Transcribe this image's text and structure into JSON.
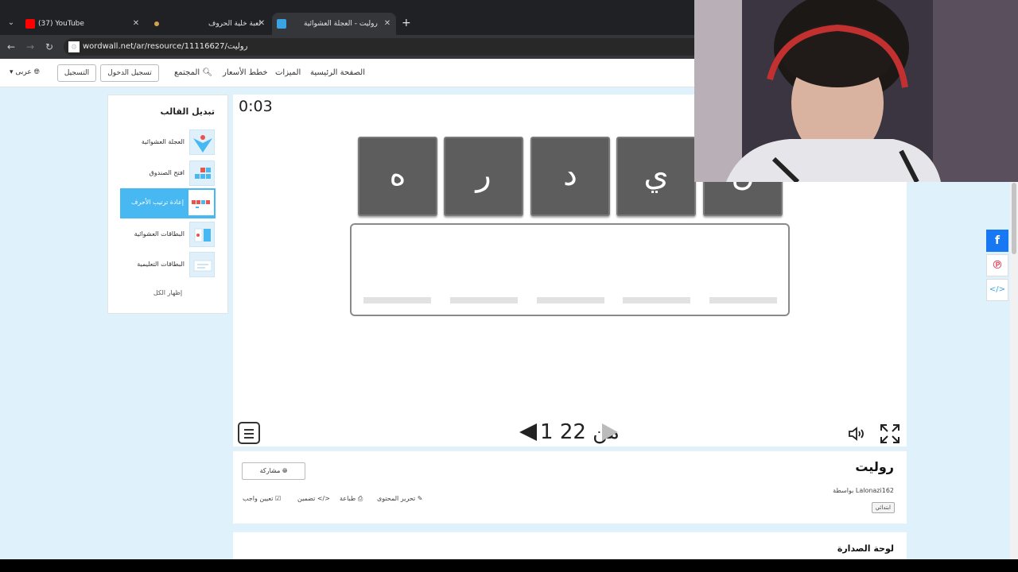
{
  "tabs": [
    {
      "title": "(37) YouTube",
      "favicon_color": "#ff0000"
    },
    {
      "title": "لعبة خلية الحروف",
      "favicon_color": "#d4a24c"
    },
    {
      "title": "روليت - العجلة العشوائية",
      "favicon_color": "#3aa3e3"
    }
  ],
  "url": "wordwall.net/ar/resource/11116627/روليت",
  "nav": {
    "home": "الصفحة الرئيسية",
    "features": "الميزات",
    "pricing": "خطط الأسعار",
    "community": "المجتمع",
    "login": "تسجيل الدخول",
    "signup": "التسجيل",
    "language": "عربى"
  },
  "templates": {
    "title": "تبديل القالب",
    "items": [
      {
        "label": "العجلة العشوائية"
      },
      {
        "label": "افتح الصندوق"
      },
      {
        "label": "إعادة ترتيب الأحرف"
      },
      {
        "label": "البطاقات العشوائية"
      },
      {
        "label": "البطاقات التعليمية"
      }
    ],
    "show_all": "إظهار الكل"
  },
  "game": {
    "timer": "0:03",
    "tiles": [
      "ه",
      "ر",
      "د",
      "ي",
      "ن"
    ],
    "pager_text": "1 من 22"
  },
  "activity": {
    "title": "روليت",
    "byline": "بواسطة Lalonazi162",
    "level": "ابتدائي",
    "share": "مشاركة",
    "edit": "تحرير المحتوى",
    "print": "طباعة",
    "embed": "تضمين",
    "assign": "تعيين واجب"
  },
  "leaderboard": {
    "title": "لوحة الصدارة"
  },
  "colors": {
    "accent": "#47b8f2",
    "tile": "#5d5d5d",
    "facebook": "#1877f2",
    "pinterest": "#e60023"
  }
}
